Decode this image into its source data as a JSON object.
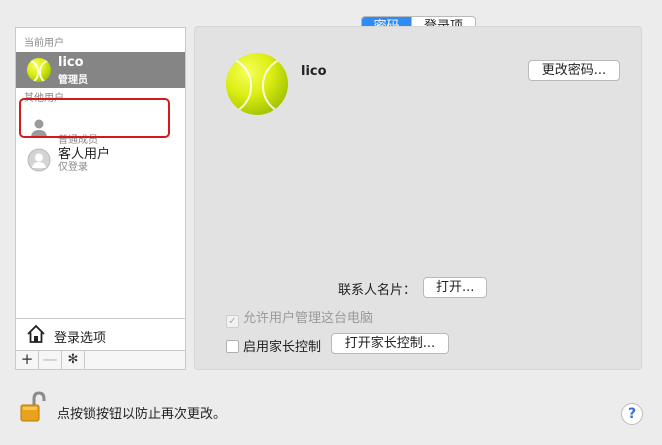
{
  "sidebar": {
    "current_header": "当前用户",
    "other_header": "其他用户",
    "current_user": {
      "name": "lico",
      "role": "管理员"
    },
    "member_user": {
      "name": "",
      "role": "普通成员"
    },
    "guest_user": {
      "name": "客人用户",
      "role": "仅登录"
    },
    "login_options": "登录选项",
    "toolbar": {
      "add": "+",
      "remove": "—",
      "gear": "✻"
    }
  },
  "tabs": [
    "密码",
    "登录项"
  ],
  "main": {
    "user_name": "lico",
    "change_password_button": "更改密码...",
    "contact_card_label": "联系人名片：",
    "open_button": "打开...",
    "allow_admin_label": "允许用户管理这台电脑",
    "allow_admin_checked": true,
    "parental_label": "启用家长控制",
    "parental_checked": false,
    "open_parental_button": "打开家长控制..."
  },
  "footer": {
    "lock_text": "点按锁按钮以防止再次更改。",
    "help": "?"
  },
  "colors": {
    "accent": "#2f8cf5",
    "selected_row": "#858585",
    "highlight": "#d11a1a"
  }
}
